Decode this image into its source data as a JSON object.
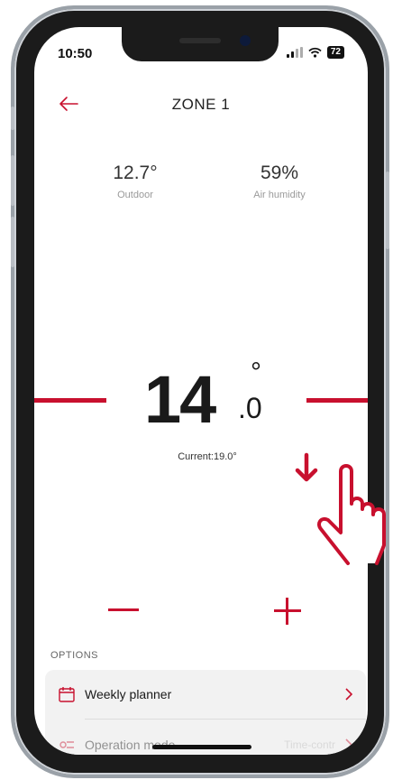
{
  "status_bar": {
    "time": "10:50",
    "battery": "72"
  },
  "header": {
    "title": "ZONE 1"
  },
  "stats": {
    "outdoor": {
      "value": "12.7°",
      "label": "Outdoor"
    },
    "humidity": {
      "value": "59%",
      "label": "Air humidity"
    }
  },
  "setpoint": {
    "integer": "14",
    "decimal": ".0",
    "degree": "°"
  },
  "current": "Current:19.0°",
  "options": {
    "heading": "OPTIONS",
    "items": [
      {
        "label": "Weekly planner",
        "value": ""
      },
      {
        "label": "Operation mode",
        "value": "Time-contr"
      }
    ]
  },
  "colors": {
    "accent": "#c8102e",
    "text": "#1a1a1a",
    "muted": "#9a9a9a"
  }
}
